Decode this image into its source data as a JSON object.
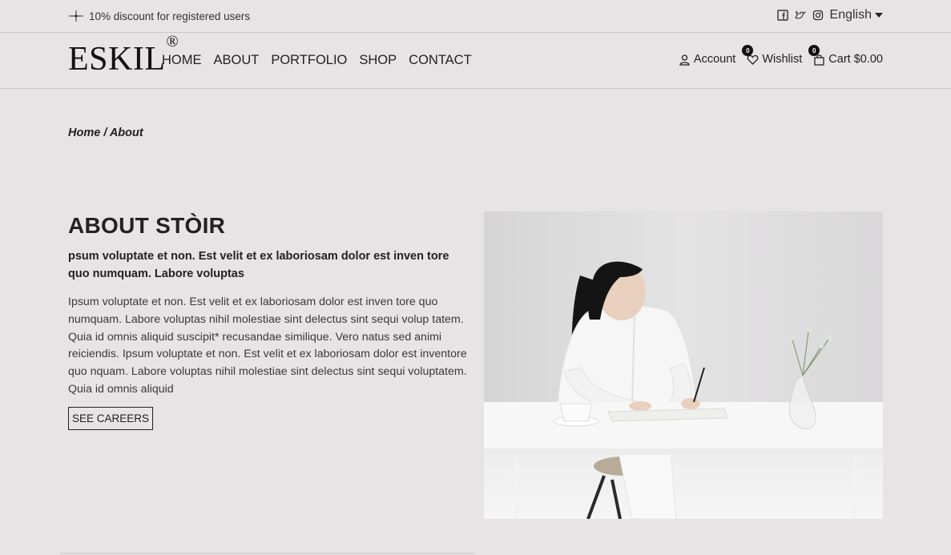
{
  "topbar": {
    "promo_text": "10% discount for registered users",
    "promo_icon": "sparkle-icon",
    "social_icons": [
      "facebook-icon",
      "twitter-icon",
      "instagram-icon"
    ],
    "language": "English"
  },
  "header": {
    "logo_text": "ESKIL",
    "logo_mark": "®",
    "menu": [
      "HOME",
      "ABOUT",
      "PORTFOLIO",
      "SHOP",
      "CONTACT"
    ],
    "account_label": "Account",
    "wishlist_label": "Wishlist",
    "wishlist_count": "0",
    "cart_label": "Cart $0.00",
    "cart_count": "0"
  },
  "breadcrumb": "Home / About",
  "about": {
    "title": "ABOUT STÒIR",
    "lead": "psum voluptate et non. Est velit et ex laboriosam dolor est inven tore quo numquam. Labore voluptas",
    "body": "Ipsum voluptate et non. Est velit et ex laboriosam dolor est inven tore quo numquam. Labore voluptas nihil molestiae sint delectus sint sequi volup tatem. Quia id omnis aliquid suscipit* recusandae similique. Vero natus sed animi reiciendis. Ipsum voluptate et non. Est velit et ex laboriosam dolor est inventore quo nquam. Labore voluptas nihil molestiae sint delectus sint sequi voluptatem. Quia id omnis aliquid",
    "button_label": "SEE CAREERS"
  }
}
